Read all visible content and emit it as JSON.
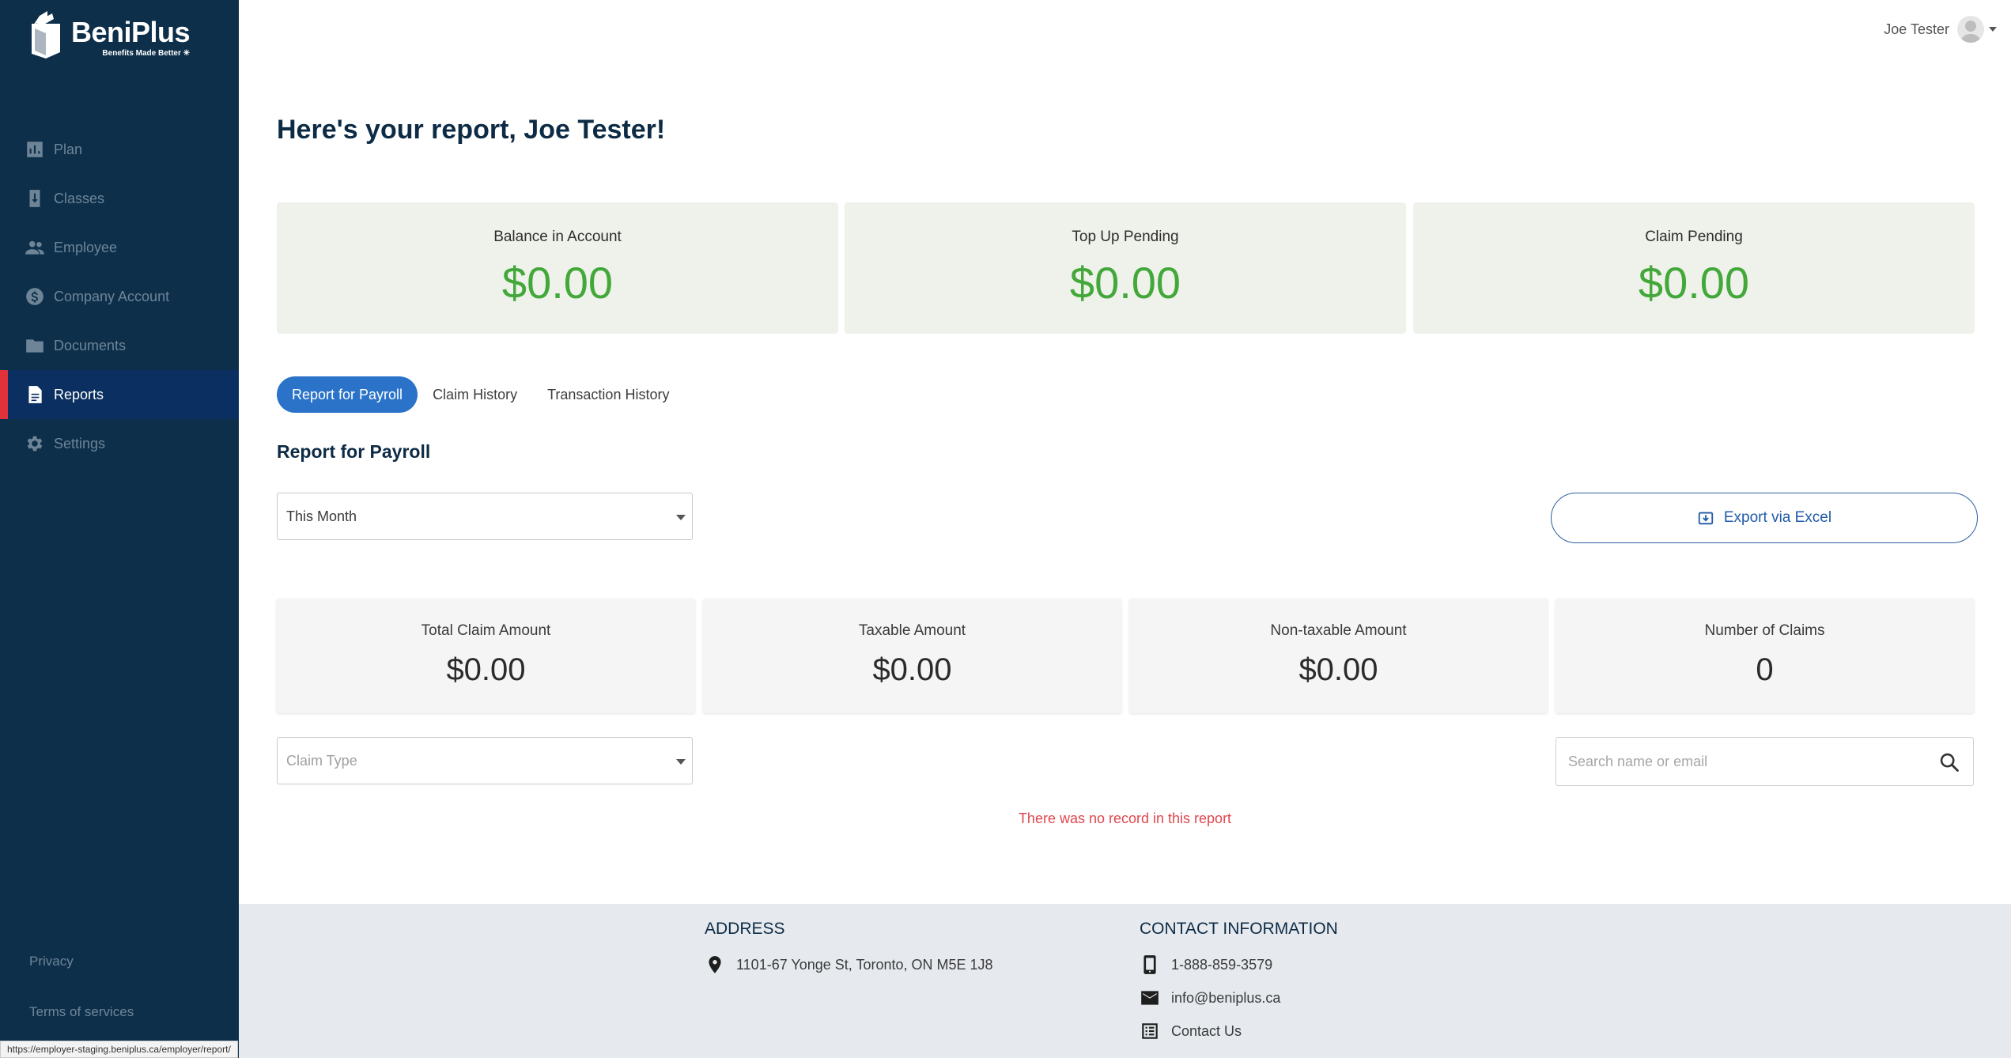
{
  "brand": {
    "name": "BeniPlus",
    "tagline": "Benefits Made Better ✳"
  },
  "sidebar": {
    "items": [
      {
        "label": "Plan",
        "icon": "bar-chart-icon"
      },
      {
        "label": "Classes",
        "icon": "download-doc-icon"
      },
      {
        "label": "Employee",
        "icon": "people-icon"
      },
      {
        "label": "Company Account",
        "icon": "dollar-circle-icon"
      },
      {
        "label": "Documents",
        "icon": "folder-icon"
      },
      {
        "label": "Reports",
        "icon": "document-icon",
        "active": true
      },
      {
        "label": "Settings",
        "icon": "gear-icon"
      }
    ],
    "footer_links": [
      "Privacy",
      "Terms of services"
    ]
  },
  "status_bar": {
    "url": "https://employer-staging.beniplus.ca/employer/report/"
  },
  "user": {
    "name": "Joe Tester"
  },
  "page": {
    "title": "Here's your report, Joe Tester!"
  },
  "summary_cards": [
    {
      "label": "Balance in Account",
      "value": "$0.00"
    },
    {
      "label": "Top Up Pending",
      "value": "$0.00"
    },
    {
      "label": "Claim Pending",
      "value": "$0.00"
    }
  ],
  "tabs": [
    {
      "label": "Report for Payroll",
      "active": true
    },
    {
      "label": "Claim History"
    },
    {
      "label": "Transaction History"
    }
  ],
  "report": {
    "section_title": "Report for Payroll",
    "period_select": "This Month",
    "export_label": "Export via Excel",
    "stats": [
      {
        "label": "Total Claim Amount",
        "value": "$0.00"
      },
      {
        "label": "Taxable Amount",
        "value": "$0.00"
      },
      {
        "label": "Non-taxable Amount",
        "value": "$0.00"
      },
      {
        "label": "Number of Claims",
        "value": "0"
      }
    ],
    "claim_type_placeholder": "Claim Type",
    "search_placeholder": "Search name or email",
    "empty_message": "There was no record in this report"
  },
  "footer": {
    "address_heading": "ADDRESS",
    "address": "1101-67 Yonge St, Toronto, ON M5E 1J8",
    "contact_heading": "CONTACT INFORMATION",
    "phone": "1-888-859-3579",
    "email": "info@beniplus.ca",
    "contact_link": "Contact Us"
  },
  "colors": {
    "sidebar_bg": "#0d2f4a",
    "active_accent": "#e0323b",
    "primary_blue": "#2a73c9",
    "money_green": "#43a83a",
    "error_red": "#e0464e"
  }
}
